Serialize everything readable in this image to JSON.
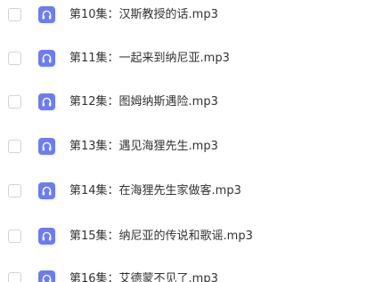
{
  "colors": {
    "icon_bg": "#6c7cf4",
    "text": "#333333",
    "checkbox_border": "#cfd3d9"
  },
  "files": [
    {
      "name": "第10集：汉斯教授的话.mp3",
      "icon": "headphones-icon",
      "checked": false
    },
    {
      "name": "第11集：一起来到纳尼亚.mp3",
      "icon": "headphones-icon",
      "checked": false
    },
    {
      "name": "第12集：图姆纳斯遇险.mp3",
      "icon": "headphones-icon",
      "checked": false
    },
    {
      "name": "第13集：遇见海狸先生.mp3",
      "icon": "headphones-icon",
      "checked": false
    },
    {
      "name": "第14集：在海狸先生家做客.mp3",
      "icon": "headphones-icon",
      "checked": false
    },
    {
      "name": "第15集：纳尼亚的传说和歌谣.mp3",
      "icon": "headphones-icon",
      "checked": false
    },
    {
      "name": "第16集：艾德蒙不见了.mp3",
      "icon": "headphones-icon",
      "checked": false
    }
  ]
}
